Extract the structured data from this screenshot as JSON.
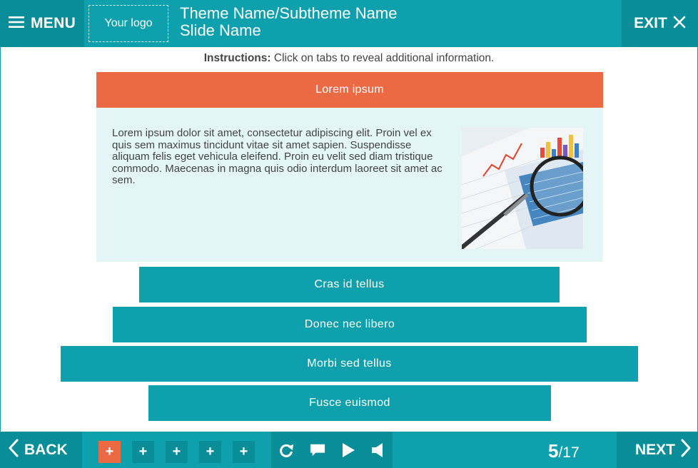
{
  "header": {
    "menu_label": "MENU",
    "logo_text": "Your logo",
    "title_line1": "Theme Name/Subtheme Name",
    "title_line2": "Slide Name",
    "exit_label": "EXIT"
  },
  "instructions": {
    "prefix": "Instructions:",
    "text": " Click on tabs to reveal additional information."
  },
  "open_tab": {
    "label": "Lorem ipsum",
    "body": "Lorem ipsum dolor sit amet, consectetur adipiscing elit. Proin vel ex quis sem maximus tincidunt vitae sit amet sapien. Suspendisse aliquam felis eget vehicula eleifend. Proin eu velit sed diam tristique commodo. Maecenas in magna quis odio interdum laoreet sit amet ac sem."
  },
  "tabs": [
    {
      "label": "Cras id tellus"
    },
    {
      "label": "Donec nec libero"
    },
    {
      "label": "Morbi sed tellus"
    },
    {
      "label": "Fusce euismod"
    }
  ],
  "footer": {
    "back_label": "BACK",
    "next_label": "NEXT",
    "dots": [
      "+",
      "+",
      "+",
      "+",
      "+"
    ],
    "page_current": "5",
    "page_total": "/17"
  },
  "colors": {
    "teal": "#0fa0ad",
    "teal_dark": "#088d99",
    "orange": "#ec6a43",
    "panel_bg": "#e4f5f6"
  },
  "icons": [
    "hamburger-icon",
    "close-icon",
    "chevron-left-icon",
    "chevron-right-icon",
    "refresh-icon",
    "chat-icon",
    "play-icon",
    "speaker-icon"
  ]
}
